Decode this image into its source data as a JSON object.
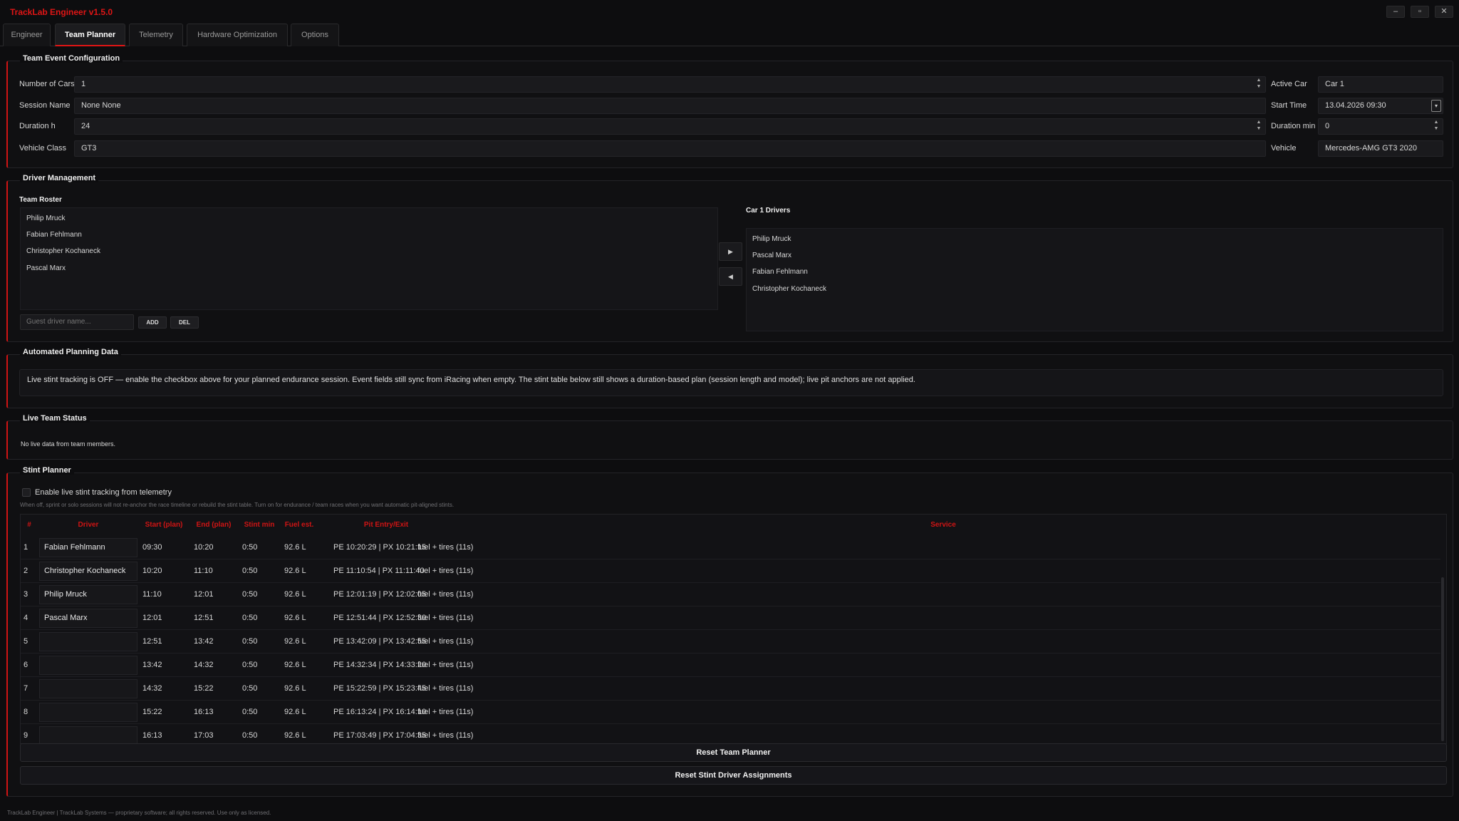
{
  "app": {
    "title": "TrackLab Engineer v1.5.0",
    "window_controls": {
      "minimize": "–",
      "maximize": "▫",
      "close": "✕"
    },
    "accent_color": "#e01515"
  },
  "tabs": [
    {
      "label": "Engineer",
      "active": false
    },
    {
      "label": "Team Planner",
      "active": true
    },
    {
      "label": "Telemetry",
      "active": false
    },
    {
      "label": "Hardware Optimization",
      "active": false
    },
    {
      "label": "Options",
      "active": false
    }
  ],
  "event_config": {
    "title": "Team Event Configuration",
    "number_of_cars": {
      "label": "Number of Cars",
      "value": "1"
    },
    "session_name": {
      "label": "Session Name",
      "value": "None None"
    },
    "duration_h": {
      "label": "Duration h",
      "value": "24"
    },
    "vehicle_class": {
      "label": "Vehicle Class",
      "value": "GT3"
    },
    "active_car": {
      "label": "Active Car",
      "value": "Car 1"
    },
    "start_time": {
      "label": "Start Time",
      "value": "13.04.2026 09:30"
    },
    "duration_min": {
      "label": "Duration min",
      "value": "0"
    },
    "vehicle": {
      "label": "Vehicle",
      "value": "Mercedes-AMG GT3 2020"
    }
  },
  "driver_mgmt": {
    "title": "Driver Management",
    "roster_title": "Team Roster",
    "roster": [
      "Philip Mruck",
      "Fabian Fehlmann",
      "Christopher Kochaneck",
      "Pascal Marx"
    ],
    "car_drivers_title": "Car 1 Drivers",
    "car_drivers": [
      "Philip Mruck",
      "Pascal Marx",
      "Fabian Fehlmann",
      "Christopher Kochaneck"
    ],
    "move_right": "▶",
    "move_left": "◀",
    "guest_placeholder": "Guest driver name...",
    "add_label": "ADD",
    "del_label": "DEL"
  },
  "planning": {
    "title": "Automated Planning Data",
    "message": "Live stint tracking is OFF — enable the checkbox above for your planned endurance session. Event fields still sync from iRacing when empty. The stint table below still shows a duration-based plan (session length and model); live pit anchors are not applied."
  },
  "live_status": {
    "title": "Live Team Status",
    "message": "No live data from team members."
  },
  "stint_planner": {
    "title": "Stint Planner",
    "checkbox_label": "Enable live stint tracking from telemetry",
    "checkbox_checked": false,
    "hint": "When off, sprint or solo sessions will not re-anchor the race timeline or rebuild the stint table. Turn on for endurance / team races when you want automatic pit-aligned stints.",
    "headers": [
      "#",
      "Driver",
      "Start (plan)",
      "End (plan)",
      "Stint min",
      "Fuel est.",
      "Pit Entry/Exit",
      "Service"
    ],
    "rows": [
      {
        "n": "1",
        "driver": "Fabian Fehlmann",
        "start": "09:30",
        "end": "10:20",
        "stint": "0:50",
        "fuel": "92.6 L",
        "pit": "PE 10:20:29 | PX 10:21:15",
        "service": "fuel + tires (11s)"
      },
      {
        "n": "2",
        "driver": "Christopher Kochaneck",
        "start": "10:20",
        "end": "11:10",
        "stint": "0:50",
        "fuel": "92.6 L",
        "pit": "PE 11:10:54 | PX 11:11:40",
        "service": "fuel + tires (11s)"
      },
      {
        "n": "3",
        "driver": "Philip Mruck",
        "start": "11:10",
        "end": "12:01",
        "stint": "0:50",
        "fuel": "92.6 L",
        "pit": "PE 12:01:19 | PX 12:02:05",
        "service": "fuel + tires (11s)"
      },
      {
        "n": "4",
        "driver": "Pascal Marx",
        "start": "12:01",
        "end": "12:51",
        "stint": "0:50",
        "fuel": "92.6 L",
        "pit": "PE 12:51:44 | PX 12:52:30",
        "service": "fuel + tires (11s)"
      },
      {
        "n": "5",
        "driver": "",
        "start": "12:51",
        "end": "13:42",
        "stint": "0:50",
        "fuel": "92.6 L",
        "pit": "PE 13:42:09 | PX 13:42:55",
        "service": "fuel + tires (11s)"
      },
      {
        "n": "6",
        "driver": "",
        "start": "13:42",
        "end": "14:32",
        "stint": "0:50",
        "fuel": "92.6 L",
        "pit": "PE 14:32:34 | PX 14:33:20",
        "service": "fuel + tires (11s)"
      },
      {
        "n": "7",
        "driver": "",
        "start": "14:32",
        "end": "15:22",
        "stint": "0:50",
        "fuel": "92.6 L",
        "pit": "PE 15:22:59 | PX 15:23:45",
        "service": "fuel + tires (11s)"
      },
      {
        "n": "8",
        "driver": "",
        "start": "15:22",
        "end": "16:13",
        "stint": "0:50",
        "fuel": "92.6 L",
        "pit": "PE 16:13:24 | PX 16:14:10",
        "service": "fuel + tires (11s)"
      },
      {
        "n": "9",
        "driver": "",
        "start": "16:13",
        "end": "17:03",
        "stint": "0:50",
        "fuel": "92.6 L",
        "pit": "PE 17:03:49 | PX 17:04:35",
        "service": "fuel + tires (11s)"
      }
    ],
    "reset_planner_label": "Reset Team Planner",
    "reset_assignments_label": "Reset Stint Driver Assignments"
  },
  "footer": "TrackLab Engineer | TrackLab Systems — proprietary software; all rights reserved. Use only as licensed."
}
